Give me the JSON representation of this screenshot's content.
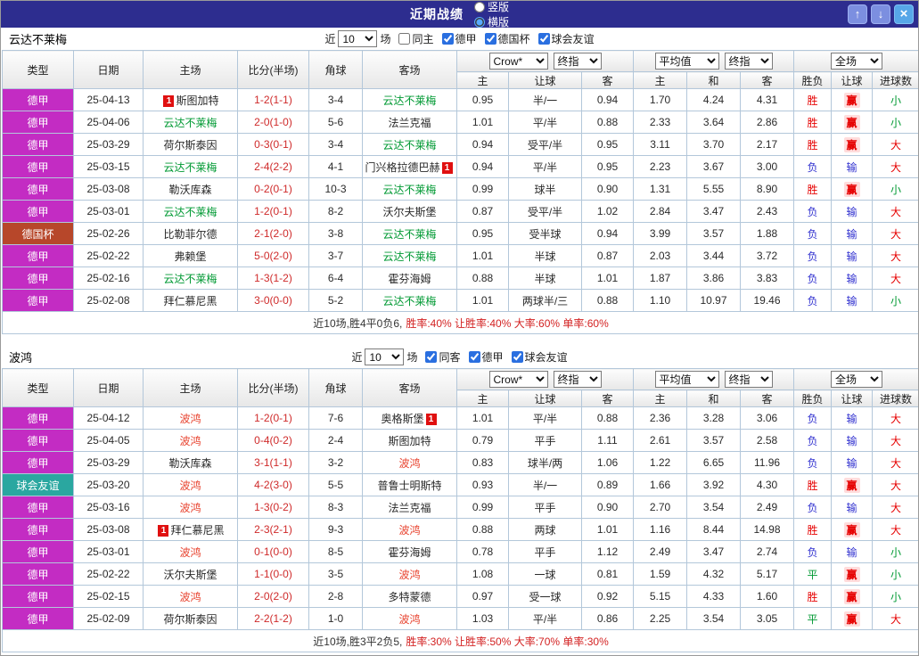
{
  "titlebar": {
    "title": "近期战绩",
    "layout_options": [
      {
        "key": "vertical",
        "label": "竖版",
        "selected": false
      },
      {
        "key": "horizontal",
        "label": "横版",
        "selected": true
      }
    ],
    "window_buttons": [
      {
        "key": "up",
        "glyph": "↑"
      },
      {
        "key": "down",
        "glyph": "↓"
      },
      {
        "key": "close",
        "glyph": "×"
      }
    ]
  },
  "colors": {
    "titlebar_bg": "#2d2d8f",
    "type_league": "#c32cc3",
    "type_cup": "#b7472a",
    "type_friendly": "#2aa7a0",
    "card": "#e01010",
    "score": "#cf2a2a",
    "outcome_win": "#e60000",
    "outcome_draw": "#009933",
    "outcome_loss": "#3030cf",
    "win_chip_bg": "#ffdcdc",
    "rates_text": "#d32222"
  },
  "table_header": {
    "fixed": [
      "类型",
      "日期",
      "主场",
      "比分(半场)",
      "角球",
      "客场"
    ],
    "sub": [
      "主",
      "让球",
      "客",
      "主",
      "和",
      "客",
      "胜负",
      "让球",
      "进球数"
    ]
  },
  "sections": [
    {
      "team": "云达不莱梅",
      "focus_color": "#009933",
      "filter": {
        "prefix": "近",
        "count": "10",
        "suffix": "场",
        "checks": [
          {
            "key": "same-home",
            "label": "同主",
            "checked": false
          },
          {
            "key": "bundesliga",
            "label": "德甲",
            "checked": true
          },
          {
            "key": "dfb-pokal",
            "label": "德国杯",
            "checked": true
          },
          {
            "key": "club-friendly",
            "label": "球会友谊",
            "checked": true
          }
        ]
      },
      "dropdowns": {
        "odds": [
          "Crow*",
          "终指"
        ],
        "avg": [
          "平均值",
          "终指"
        ],
        "scope": [
          "全场"
        ]
      },
      "rows": [
        {
          "type": "德甲",
          "type_key": "league",
          "date": "25-04-13",
          "home": {
            "name": "斯图加特",
            "focus": false,
            "card": "before"
          },
          "score": "1-2(1-1)",
          "corner": "3-4",
          "away": {
            "name": "云达不莱梅",
            "focus": true,
            "card": ""
          },
          "odds": [
            "0.95",
            "半/一",
            "0.94"
          ],
          "avg": [
            "1.70",
            "4.24",
            "4.31"
          ],
          "result": "胜",
          "handicap": "赢",
          "goals": "小"
        },
        {
          "type": "德甲",
          "type_key": "league",
          "date": "25-04-06",
          "home": {
            "name": "云达不莱梅",
            "focus": true,
            "card": ""
          },
          "score": "2-0(1-0)",
          "corner": "5-6",
          "away": {
            "name": "法兰克福",
            "focus": false,
            "card": ""
          },
          "odds": [
            "1.01",
            "平/半",
            "0.88"
          ],
          "avg": [
            "2.33",
            "3.64",
            "2.86"
          ],
          "result": "胜",
          "handicap": "赢",
          "goals": "小"
        },
        {
          "type": "德甲",
          "type_key": "league",
          "date": "25-03-29",
          "home": {
            "name": "荷尔斯泰因",
            "focus": false,
            "card": ""
          },
          "score": "0-3(0-1)",
          "corner": "3-4",
          "away": {
            "name": "云达不莱梅",
            "focus": true,
            "card": ""
          },
          "odds": [
            "0.94",
            "受平/半",
            "0.95"
          ],
          "avg": [
            "3.11",
            "3.70",
            "2.17"
          ],
          "result": "胜",
          "handicap": "赢",
          "goals": "大"
        },
        {
          "type": "德甲",
          "type_key": "league",
          "date": "25-03-15",
          "home": {
            "name": "云达不莱梅",
            "focus": true,
            "card": ""
          },
          "score": "2-4(2-2)",
          "corner": "4-1",
          "away": {
            "name": "门兴格拉德巴赫",
            "focus": false,
            "card": "after"
          },
          "odds": [
            "0.94",
            "平/半",
            "0.95"
          ],
          "avg": [
            "2.23",
            "3.67",
            "3.00"
          ],
          "result": "负",
          "handicap": "输",
          "goals": "大"
        },
        {
          "type": "德甲",
          "type_key": "league",
          "date": "25-03-08",
          "home": {
            "name": "勒沃库森",
            "focus": false,
            "card": ""
          },
          "score": "0-2(0-1)",
          "corner": "10-3",
          "away": {
            "name": "云达不莱梅",
            "focus": true,
            "card": ""
          },
          "odds": [
            "0.99",
            "球半",
            "0.90"
          ],
          "avg": [
            "1.31",
            "5.55",
            "8.90"
          ],
          "result": "胜",
          "handicap": "赢",
          "goals": "小"
        },
        {
          "type": "德甲",
          "type_key": "league",
          "date": "25-03-01",
          "home": {
            "name": "云达不莱梅",
            "focus": true,
            "card": ""
          },
          "score": "1-2(0-1)",
          "corner": "8-2",
          "away": {
            "name": "沃尔夫斯堡",
            "focus": false,
            "card": ""
          },
          "odds": [
            "0.87",
            "受平/半",
            "1.02"
          ],
          "avg": [
            "2.84",
            "3.47",
            "2.43"
          ],
          "result": "负",
          "handicap": "输",
          "goals": "大"
        },
        {
          "type": "德国杯",
          "type_key": "cup",
          "date": "25-02-26",
          "home": {
            "name": "比勒菲尔德",
            "focus": false,
            "card": ""
          },
          "score": "2-1(2-0)",
          "corner": "3-8",
          "away": {
            "name": "云达不莱梅",
            "focus": true,
            "card": ""
          },
          "odds": [
            "0.95",
            "受半球",
            "0.94"
          ],
          "avg": [
            "3.99",
            "3.57",
            "1.88"
          ],
          "result": "负",
          "handicap": "输",
          "goals": "大"
        },
        {
          "type": "德甲",
          "type_key": "league",
          "date": "25-02-22",
          "home": {
            "name": "弗赖堡",
            "focus": false,
            "card": ""
          },
          "score": "5-0(2-0)",
          "corner": "3-7",
          "away": {
            "name": "云达不莱梅",
            "focus": true,
            "card": ""
          },
          "odds": [
            "1.01",
            "半球",
            "0.87"
          ],
          "avg": [
            "2.03",
            "3.44",
            "3.72"
          ],
          "result": "负",
          "handicap": "输",
          "goals": "大"
        },
        {
          "type": "德甲",
          "type_key": "league",
          "date": "25-02-16",
          "home": {
            "name": "云达不莱梅",
            "focus": true,
            "card": ""
          },
          "score": "1-3(1-2)",
          "corner": "6-4",
          "away": {
            "name": "霍芬海姆",
            "focus": false,
            "card": ""
          },
          "odds": [
            "0.88",
            "半球",
            "1.01"
          ],
          "avg": [
            "1.87",
            "3.86",
            "3.83"
          ],
          "result": "负",
          "handicap": "输",
          "goals": "大"
        },
        {
          "type": "德甲",
          "type_key": "league",
          "date": "25-02-08",
          "home": {
            "name": "拜仁慕尼黑",
            "focus": false,
            "card": ""
          },
          "score": "3-0(0-0)",
          "corner": "5-2",
          "away": {
            "name": "云达不莱梅",
            "focus": true,
            "card": ""
          },
          "odds": [
            "1.01",
            "两球半/三",
            "0.88"
          ],
          "avg": [
            "1.10",
            "10.97",
            "19.46"
          ],
          "result": "负",
          "handicap": "输",
          "goals": "小"
        }
      ],
      "summary": {
        "record": "近10场,胜4平0负6,",
        "rates": "胜率:40% 让胜率:40% 大率:60% 单率:60%"
      }
    },
    {
      "team": "波鸿",
      "focus_color": "#e8432f",
      "filter": {
        "prefix": "近",
        "count": "10",
        "suffix": "场",
        "checks": [
          {
            "key": "same-away",
            "label": "同客",
            "checked": true
          },
          {
            "key": "bundesliga",
            "label": "德甲",
            "checked": true
          },
          {
            "key": "club-friendly",
            "label": "球会友谊",
            "checked": true
          }
        ]
      },
      "dropdowns": {
        "odds": [
          "Crow*",
          "终指"
        ],
        "avg": [
          "平均值",
          "终指"
        ],
        "scope": [
          "全场"
        ]
      },
      "rows": [
        {
          "type": "德甲",
          "type_key": "league",
          "date": "25-04-12",
          "home": {
            "name": "波鸿",
            "focus": true,
            "card": ""
          },
          "score": "1-2(0-1)",
          "corner": "7-6",
          "away": {
            "name": "奥格斯堡",
            "focus": false,
            "card": "after"
          },
          "odds": [
            "1.01",
            "平/半",
            "0.88"
          ],
          "avg": [
            "2.36",
            "3.28",
            "3.06"
          ],
          "result": "负",
          "handicap": "输",
          "goals": "大"
        },
        {
          "type": "德甲",
          "type_key": "league",
          "date": "25-04-05",
          "home": {
            "name": "波鸿",
            "focus": true,
            "card": ""
          },
          "score": "0-4(0-2)",
          "corner": "2-4",
          "away": {
            "name": "斯图加特",
            "focus": false,
            "card": ""
          },
          "odds": [
            "0.79",
            "平手",
            "1.11"
          ],
          "avg": [
            "2.61",
            "3.57",
            "2.58"
          ],
          "result": "负",
          "handicap": "输",
          "goals": "大"
        },
        {
          "type": "德甲",
          "type_key": "league",
          "date": "25-03-29",
          "home": {
            "name": "勒沃库森",
            "focus": false,
            "card": ""
          },
          "score": "3-1(1-1)",
          "corner": "3-2",
          "away": {
            "name": "波鸿",
            "focus": true,
            "card": ""
          },
          "odds": [
            "0.83",
            "球半/两",
            "1.06"
          ],
          "avg": [
            "1.22",
            "6.65",
            "11.96"
          ],
          "result": "负",
          "handicap": "输",
          "goals": "大"
        },
        {
          "type": "球会友谊",
          "type_key": "friendly",
          "date": "25-03-20",
          "home": {
            "name": "波鸿",
            "focus": true,
            "card": ""
          },
          "score": "4-2(3-0)",
          "corner": "5-5",
          "away": {
            "name": "普鲁士明斯特",
            "focus": false,
            "card": ""
          },
          "odds": [
            "0.93",
            "半/一",
            "0.89"
          ],
          "avg": [
            "1.66",
            "3.92",
            "4.30"
          ],
          "result": "胜",
          "handicap": "赢",
          "goals": "大"
        },
        {
          "type": "德甲",
          "type_key": "league",
          "date": "25-03-16",
          "home": {
            "name": "波鸿",
            "focus": true,
            "card": ""
          },
          "score": "1-3(0-2)",
          "corner": "8-3",
          "away": {
            "name": "法兰克福",
            "focus": false,
            "card": ""
          },
          "odds": [
            "0.99",
            "平手",
            "0.90"
          ],
          "avg": [
            "2.70",
            "3.54",
            "2.49"
          ],
          "result": "负",
          "handicap": "输",
          "goals": "大"
        },
        {
          "type": "德甲",
          "type_key": "league",
          "date": "25-03-08",
          "home": {
            "name": "拜仁慕尼黑",
            "focus": false,
            "card": "before"
          },
          "score": "2-3(2-1)",
          "corner": "9-3",
          "away": {
            "name": "波鸿",
            "focus": true,
            "card": ""
          },
          "odds": [
            "0.88",
            "两球",
            "1.01"
          ],
          "avg": [
            "1.16",
            "8.44",
            "14.98"
          ],
          "result": "胜",
          "handicap": "赢",
          "goals": "大"
        },
        {
          "type": "德甲",
          "type_key": "league",
          "date": "25-03-01",
          "home": {
            "name": "波鸿",
            "focus": true,
            "card": ""
          },
          "score": "0-1(0-0)",
          "corner": "8-5",
          "away": {
            "name": "霍芬海姆",
            "focus": false,
            "card": ""
          },
          "odds": [
            "0.78",
            "平手",
            "1.12"
          ],
          "avg": [
            "2.49",
            "3.47",
            "2.74"
          ],
          "result": "负",
          "handicap": "输",
          "goals": "小"
        },
        {
          "type": "德甲",
          "type_key": "league",
          "date": "25-02-22",
          "home": {
            "name": "沃尔夫斯堡",
            "focus": false,
            "card": ""
          },
          "score": "1-1(0-0)",
          "corner": "3-5",
          "away": {
            "name": "波鸿",
            "focus": true,
            "card": ""
          },
          "odds": [
            "1.08",
            "一球",
            "0.81"
          ],
          "avg": [
            "1.59",
            "4.32",
            "5.17"
          ],
          "result": "平",
          "handicap": "赢",
          "goals": "小"
        },
        {
          "type": "德甲",
          "type_key": "league",
          "date": "25-02-15",
          "home": {
            "name": "波鸿",
            "focus": true,
            "card": ""
          },
          "score": "2-0(2-0)",
          "corner": "2-8",
          "away": {
            "name": "多特蒙德",
            "focus": false,
            "card": ""
          },
          "odds": [
            "0.97",
            "受一球",
            "0.92"
          ],
          "avg": [
            "5.15",
            "4.33",
            "1.60"
          ],
          "result": "胜",
          "handicap": "赢",
          "goals": "小"
        },
        {
          "type": "德甲",
          "type_key": "league",
          "date": "25-02-09",
          "home": {
            "name": "荷尔斯泰因",
            "focus": false,
            "card": ""
          },
          "score": "2-2(1-2)",
          "corner": "1-0",
          "away": {
            "name": "波鸿",
            "focus": true,
            "card": ""
          },
          "odds": [
            "1.03",
            "平/半",
            "0.86"
          ],
          "avg": [
            "2.25",
            "3.54",
            "3.05"
          ],
          "result": "平",
          "handicap": "赢",
          "goals": "大"
        }
      ],
      "summary": {
        "record": "近10场,胜3平2负5,",
        "rates": "胜率:30% 让胜率:50% 大率:70% 单率:30%"
      }
    }
  ]
}
